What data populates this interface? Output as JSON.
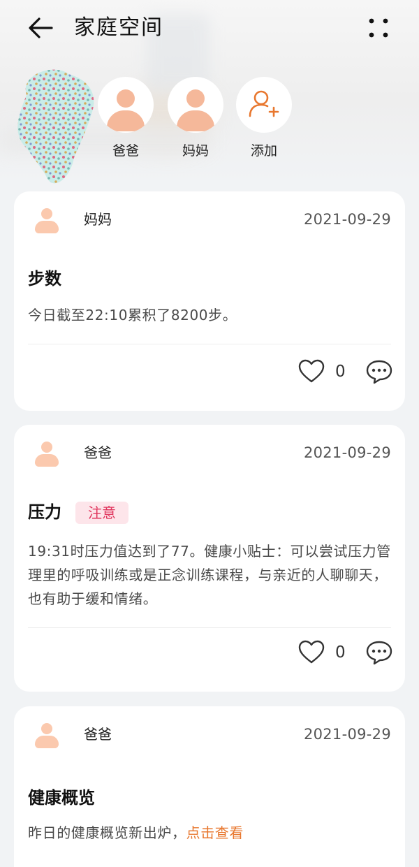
{
  "header": {
    "title": "家庭空间",
    "back_icon": "back-arrow-icon",
    "more_icon": "more-dots-icon"
  },
  "members": [
    {
      "name": "爸爸"
    },
    {
      "name": "妈妈"
    },
    {
      "name": "添加",
      "icon": "add-person-icon"
    }
  ],
  "accent": "#e8772e",
  "cards": [
    {
      "author": "妈妈",
      "date": "2021-09-29",
      "title": "步数",
      "text": "今日截至22:10累积了8200步。",
      "likes": "0"
    },
    {
      "author": "爸爸",
      "date": "2021-09-29",
      "title": "压力",
      "tag": "注意",
      "text": "19:31时压力值达到了77。健康小贴士：可以尝试压力管理里的呼吸训练或是正念训练课程，与亲近的人聊聊天，也有助于缓和情绪。",
      "likes": "0"
    },
    {
      "author": "爸爸",
      "date": "2021-09-29",
      "title": "健康概览",
      "text": "昨日的健康概览新出炉，",
      "link": "点击查看"
    }
  ]
}
